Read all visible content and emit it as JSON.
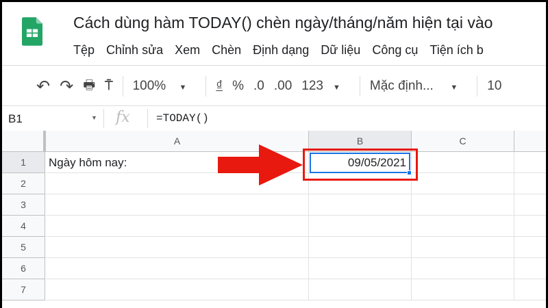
{
  "app": {
    "title": "Cách dùng hàm TODAY() chèn ngày/tháng/năm hiện tại vào",
    "logo": "google-sheets-logo"
  },
  "menu": [
    "Tệp",
    "Chỉnh sửa",
    "Xem",
    "Chèn",
    "Định dạng",
    "Dữ liệu",
    "Công cụ",
    "Tiện ích b"
  ],
  "toolbar": {
    "zoom": "100%",
    "currency": "₫",
    "percent": "%",
    "dec_decrease": ".0",
    "dec_increase": ".00",
    "format": "123",
    "font": "Mặc định...",
    "font_size": "10"
  },
  "formula_bar": {
    "cell_ref": "B1",
    "fx": "fx",
    "formula": "=TODAY()"
  },
  "columns": [
    "A",
    "B",
    "C"
  ],
  "rows": [
    "1",
    "2",
    "3",
    "4",
    "5",
    "6",
    "7"
  ],
  "cells": {
    "A1": "Ngày hôm nay:",
    "B1": "09/05/2021"
  },
  "colors": {
    "accent": "#1a73e8",
    "highlight": "#e8190f"
  }
}
